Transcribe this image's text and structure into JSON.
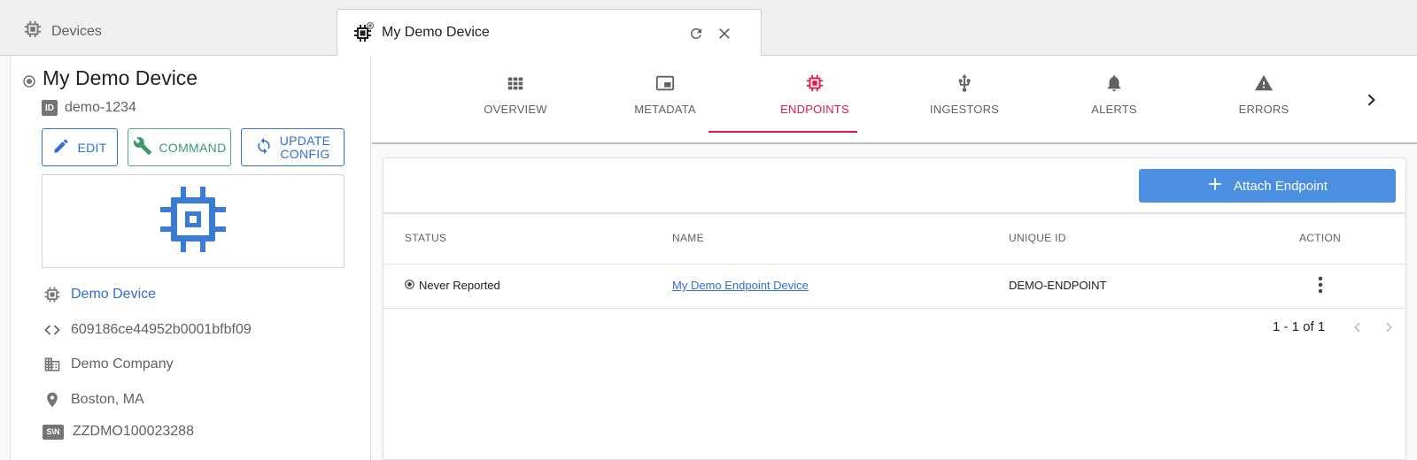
{
  "tabs": {
    "devices_label": "Devices",
    "active_label": "My Demo Device"
  },
  "device": {
    "title": "My Demo Device",
    "id": "demo-1234",
    "id_badge": "ID",
    "buttons": {
      "edit": "EDIT",
      "command": "COMMAND",
      "update_line1": "UPDATE",
      "update_line2": "CONFIG"
    },
    "type": "Demo Device",
    "object_id": "609186ce44952b0001bfbf09",
    "company": "Demo Company",
    "location": "Boston, MA",
    "serial_badge": "S\\N",
    "serial": "ZZDMO100023288"
  },
  "nav": {
    "items": [
      {
        "label": "OVERVIEW",
        "icon": "grid-icon"
      },
      {
        "label": "METADATA",
        "icon": "picture-in-picture-icon"
      },
      {
        "label": "ENDPOINTS",
        "icon": "chip-icon"
      },
      {
        "label": "INGESTORS",
        "icon": "usb-icon"
      },
      {
        "label": "ALERTS",
        "icon": "bell-icon"
      },
      {
        "label": "ERRORS",
        "icon": "warning-icon"
      }
    ],
    "active_index": 2
  },
  "endpoints": {
    "attach_label": "Attach Endpoint",
    "columns": [
      "STATUS",
      "NAME",
      "UNIQUE ID",
      "ACTION"
    ],
    "rows": [
      {
        "status": "Never Reported",
        "name": "My Demo Endpoint Device",
        "unique_id": "DEMO-ENDPOINT"
      }
    ],
    "pagination": "1 - 1 of 1"
  },
  "colors": {
    "accent_blue": "#2f6fd6",
    "active_red": "#e0194a",
    "command_green": "#3c9a6a",
    "attach_bg": "#4a8fe2"
  }
}
